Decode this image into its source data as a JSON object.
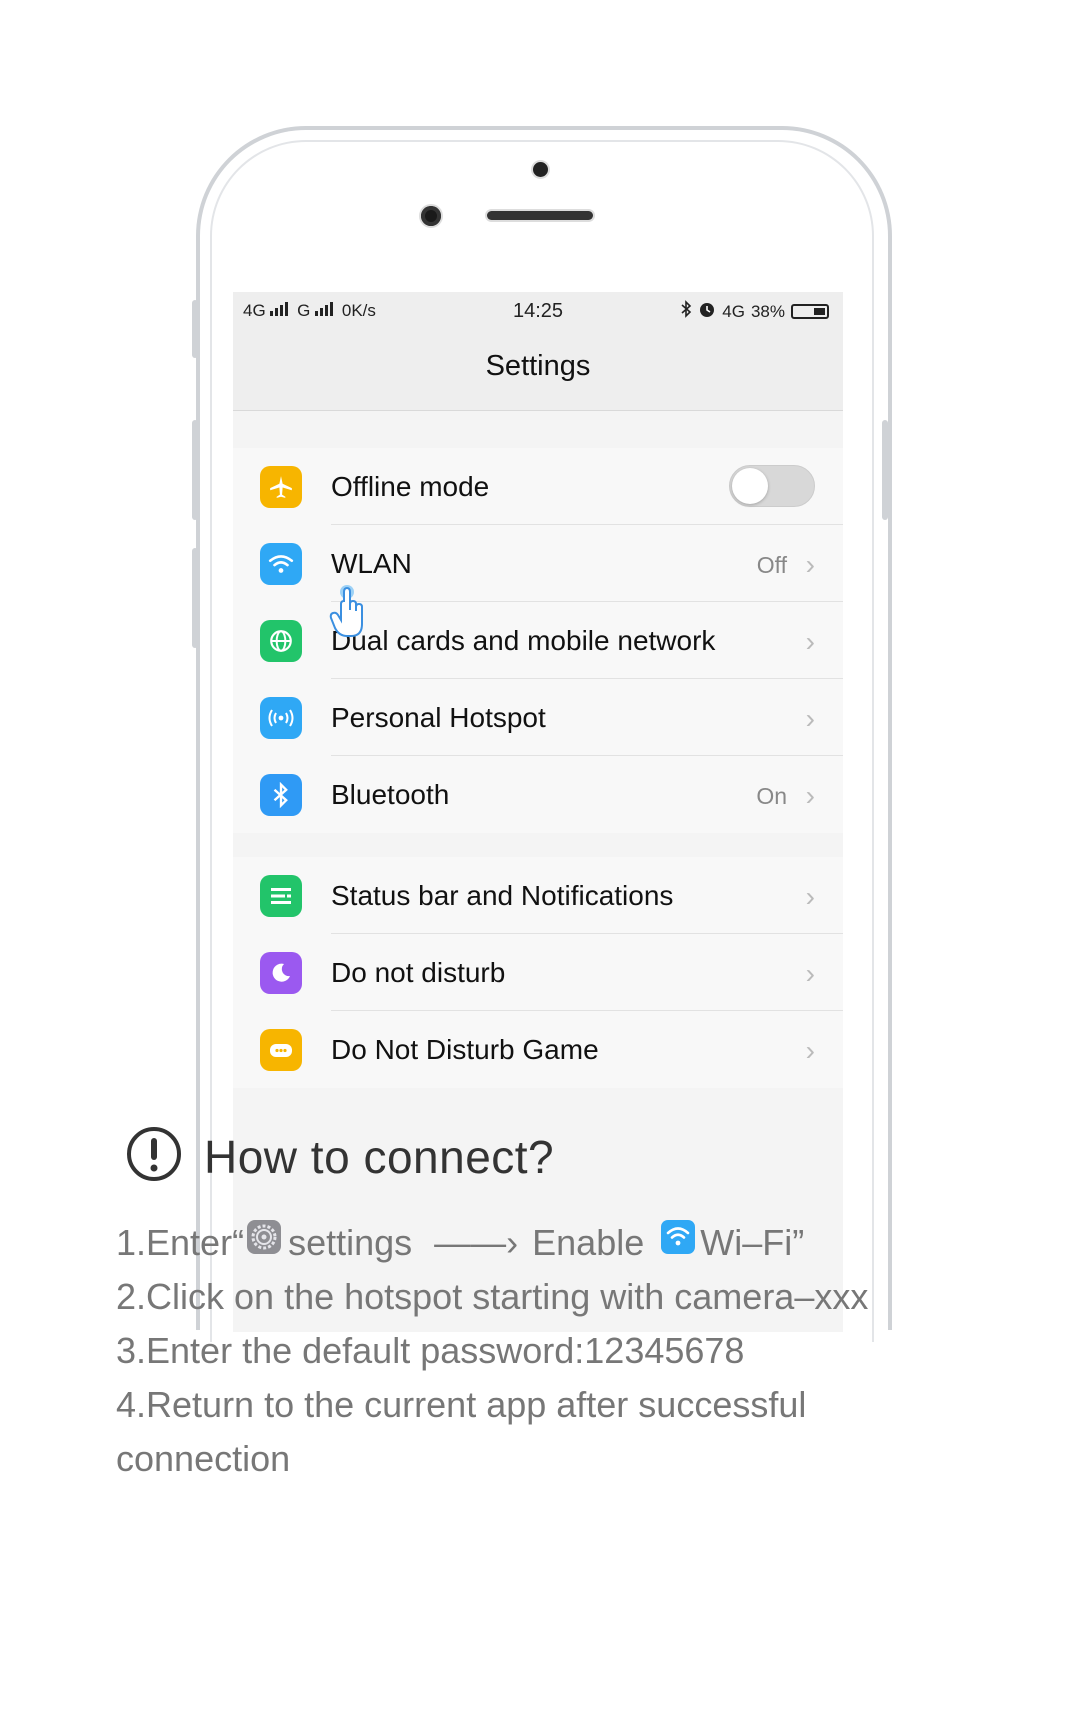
{
  "status_bar": {
    "left": "4G ▐ G ▐ 0K/s",
    "network_1": "4G",
    "network_2": "G",
    "speed": "0K/s",
    "time": "14:25",
    "right_network": "4G",
    "battery_percent": "38%"
  },
  "nav": {
    "title": "Settings"
  },
  "group1": [
    {
      "label": "Offline mode",
      "value": "",
      "icon": "airplane-icon",
      "color": "#f7b500",
      "toggle": false
    },
    {
      "label": "WLAN",
      "value": "Off",
      "icon": "wifi-icon",
      "color": "#2fa8f5"
    },
    {
      "label": "Dual cards and mobile network",
      "value": "",
      "icon": "globe-icon",
      "color": "#22c46a"
    },
    {
      "label": "Personal Hotspot",
      "value": "",
      "icon": "hotspot-icon",
      "color": "#2fa8f5"
    },
    {
      "label": "Bluetooth",
      "value": "On",
      "icon": "bluetooth-icon",
      "color": "#2f9af5"
    }
  ],
  "group2": [
    {
      "label": "Status bar and Notifications",
      "value": "",
      "icon": "list-icon",
      "color": "#22c46a"
    },
    {
      "label": "Do not disturb",
      "value": "",
      "icon": "moon-icon",
      "color": "#9b59f0"
    },
    {
      "label": "Do Not Disturb Game",
      "value": "",
      "icon": "gamepad-icon",
      "color": "#f7b500"
    }
  ],
  "instructions": {
    "heading": "How to connect?",
    "step1_a": "1.Enter“",
    "step1_b": "settings",
    "step1_arrow": "——›",
    "step1_c": "Enable",
    "step1_d": "Wi–Fi”",
    "step2": "2.Click on the hotspot starting with camera–xxx",
    "step3": "3.Enter the default password:12345678",
    "step4": "4.Return to the current app after successful connection"
  }
}
